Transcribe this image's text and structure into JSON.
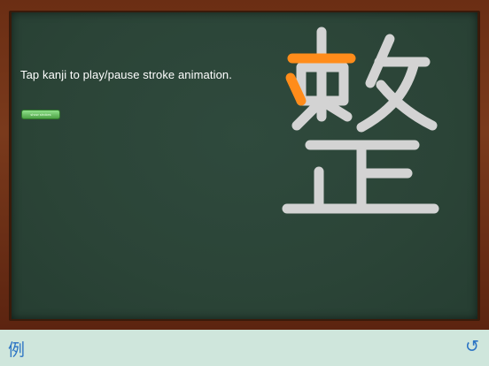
{
  "board": {
    "instruction": "Tap kanji to play/pause stroke animation.",
    "stroke_order_button_label": "show strokes"
  },
  "kanji": {
    "character": "整",
    "glyph_color": "#d3d3d3",
    "highlight_color": "#ff8c1a",
    "animation_progress_strokes": 1
  },
  "toolbar": {
    "example_label": "例",
    "reset_label": "↺"
  },
  "colors": {
    "chalkboard": "#2b4437",
    "frame": "#6b2e14",
    "toolbar_background": "#cfe6dc",
    "toolbar_accent": "#2a73c4"
  }
}
